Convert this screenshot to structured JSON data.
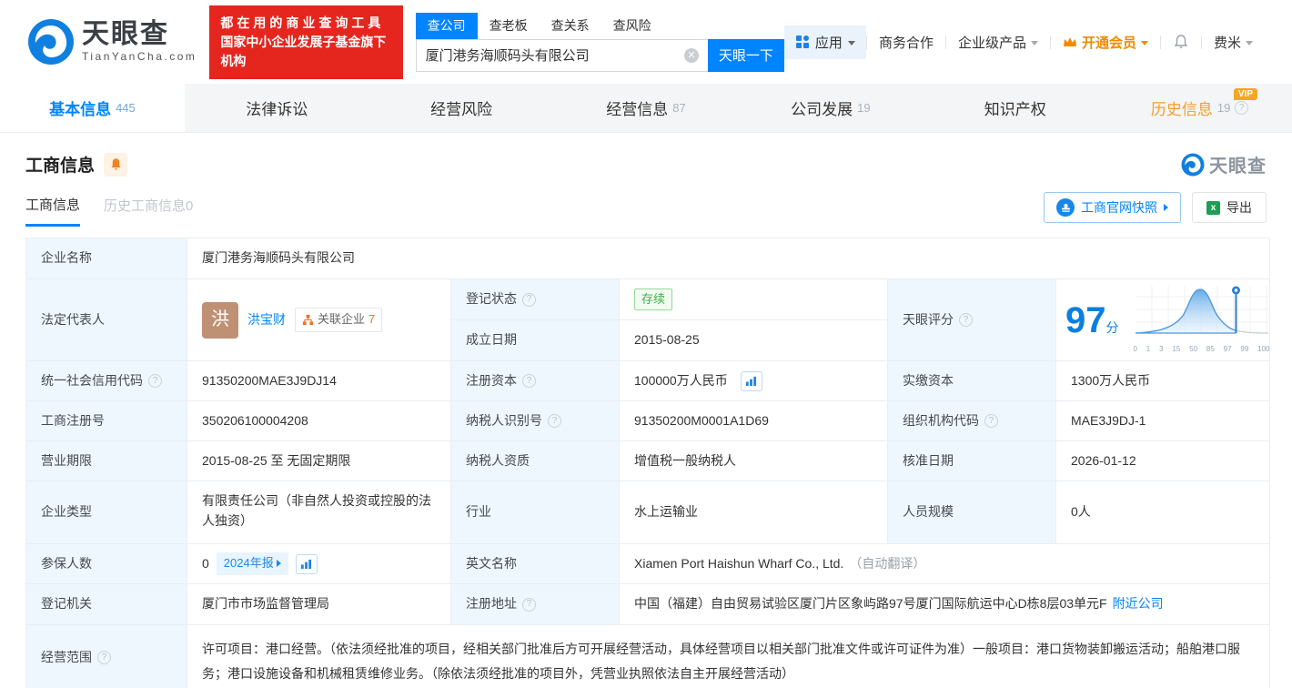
{
  "header": {
    "brand": "天眼查",
    "brand_domain": "TianYanCha.com",
    "slogan_line1": "都在用的商业查询工具",
    "slogan_line2": "国家中小企业发展子基金旗下机构",
    "search": {
      "tabs": [
        "查公司",
        "查老板",
        "查关系",
        "查风险"
      ],
      "value": "厦门港务海顺码头有限公司",
      "button": "天眼一下"
    },
    "nav": {
      "apps": "应用",
      "cooperation": "商务合作",
      "enterprise": "企业级产品",
      "vip": "开通会员",
      "user": "费米"
    }
  },
  "main_tabs": [
    {
      "label": "基本信息",
      "count": "445"
    },
    {
      "label": "法律诉讼",
      "count": ""
    },
    {
      "label": "经营风险",
      "count": ""
    },
    {
      "label": "经营信息",
      "count": "87"
    },
    {
      "label": "公司发展",
      "count": "19"
    },
    {
      "label": "知识产权",
      "count": ""
    },
    {
      "label": "历史信息",
      "count": "19",
      "badge": "VIP"
    }
  ],
  "section": {
    "title": "工商信息",
    "watermark": "天眼查",
    "subtabs": [
      "工商信息",
      "历史工商信息0"
    ],
    "snapshot_button": "工商官网快照",
    "export_button": "导出"
  },
  "biz": {
    "company_name": {
      "label": "企业名称",
      "value": "厦门港务海顺码头有限公司"
    },
    "legal_rep": {
      "label": "法定代表人",
      "avatar": "洪",
      "name": "洪宝财",
      "related_label": "关联企业",
      "related_count": "7"
    },
    "reg_status": {
      "label": "登记状态",
      "value": "存续"
    },
    "establish_date": {
      "label": "成立日期",
      "value": "2015-08-25"
    },
    "score": {
      "label": "天眼评分",
      "value": "97",
      "unit": "分",
      "axis": [
        "0",
        "1",
        "3",
        "15",
        "50",
        "85",
        "97",
        "99",
        "100"
      ]
    },
    "credit_code": {
      "label": "统一社会信用代码",
      "value": "91350200MAE3J9DJ14"
    },
    "reg_capital": {
      "label": "注册资本",
      "value": "100000万人民币"
    },
    "paid_capital": {
      "label": "实缴资本",
      "value": "1300万人民币"
    },
    "reg_number": {
      "label": "工商注册号",
      "value": "350206100004208"
    },
    "taxpayer_id": {
      "label": "纳税人识别号",
      "value": "91350200M0001A1D69"
    },
    "org_code": {
      "label": "组织机构代码",
      "value": "MAE3J9DJ-1"
    },
    "business_term": {
      "label": "营业期限",
      "value": "2015-08-25 至 无固定期限"
    },
    "taxpayer_quality": {
      "label": "纳税人资质",
      "value": "增值税一般纳税人"
    },
    "approval_date": {
      "label": "核准日期",
      "value": "2026-01-12"
    },
    "company_type": {
      "label": "企业类型",
      "value": "有限责任公司（非自然人投资或控股的法人独资）"
    },
    "industry": {
      "label": "行业",
      "value": "水上运输业"
    },
    "staff_size": {
      "label": "人员规模",
      "value": "0人"
    },
    "insured_count": {
      "label": "参保人数",
      "value": "0",
      "report_badge": "2024年报"
    },
    "english_name": {
      "label": "英文名称",
      "value": "Xiamen Port Haishun Wharf Co., Ltd.",
      "note": "（自动翻译）"
    },
    "reg_authority": {
      "label": "登记机关",
      "value": "厦门市市场监督管理局"
    },
    "reg_address": {
      "label": "注册地址",
      "value": "中国（福建）自由贸易试验区厦门片区象屿路97号厦门国际航运中心D栋8层03单元F",
      "nearby_link": "附近公司"
    },
    "business_scope": {
      "label": "经营范围",
      "value": "许可项目：港口经营。（依法须经批准的项目，经相关部门批准后方可开展经营活动，具体经营项目以相关部门批准文件或许可证件为准）一般项目：港口货物装卸搬运活动；船舶港口服务；港口设施设备和机械租赁维修业务。（除依法须经批准的项目外，凭营业执照依法自主开展经营活动）"
    }
  },
  "chart_data": {
    "type": "area",
    "title": "天眼评分分布曲线",
    "x_tick_labels": [
      "0",
      "1",
      "3",
      "15",
      "50",
      "85",
      "97",
      "99",
      "100"
    ],
    "marker_value": 97,
    "score": 97,
    "accent_color": "#0a7fe0"
  }
}
